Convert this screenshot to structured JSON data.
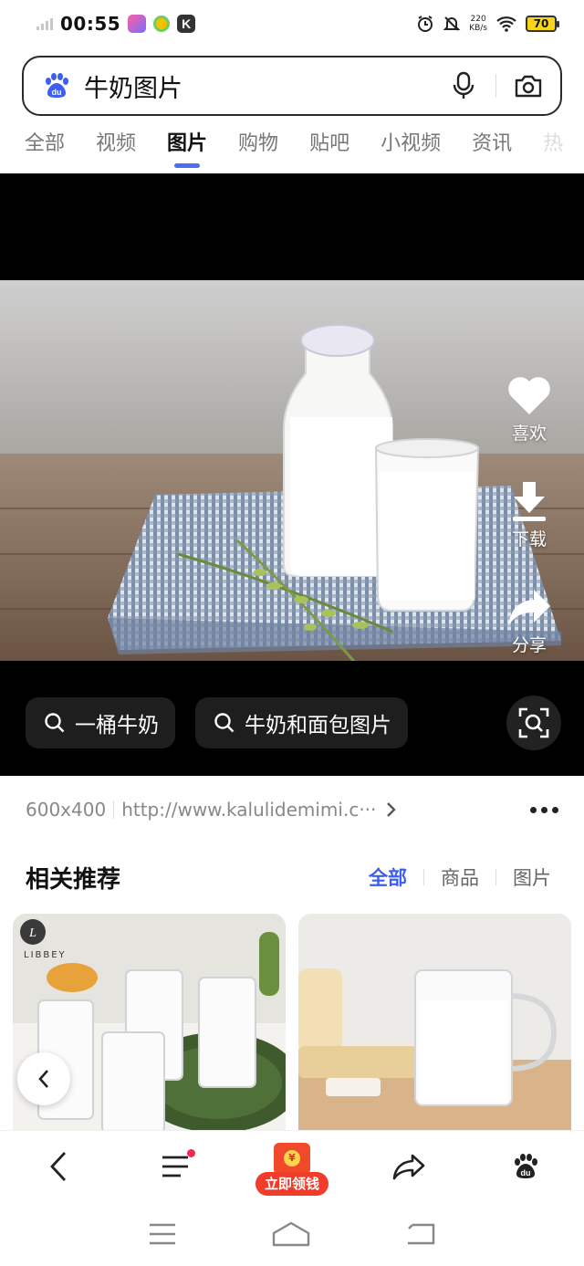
{
  "status_bar": {
    "time": "00:55",
    "net_speed_value": "220",
    "net_speed_unit": "KB/s",
    "battery": "70",
    "app_icon_k": "K"
  },
  "search": {
    "query": "牛奶图片"
  },
  "tabs": [
    "全部",
    "视频",
    "图片",
    "购物",
    "贴吧",
    "小视频",
    "资讯",
    "热"
  ],
  "active_tab": "图片",
  "viewer": {
    "actions": {
      "like": "喜欢",
      "download": "下载",
      "share": "分享"
    },
    "suggestions": [
      "一桶牛奶",
      "牛奶和面包图片"
    ]
  },
  "info": {
    "size": "600x400",
    "url": "http://www.kalulidemimi.c···"
  },
  "related": {
    "title": "相关推荐",
    "filters": [
      "全部",
      "商品",
      "图片"
    ],
    "card1_brand": "LIBBEY"
  },
  "bottom_nav": {
    "reward_label": "立即领钱",
    "coin_symbol": "¥"
  },
  "colors": {
    "accent": "#4e6ef2",
    "reward_red": "#f23c2a"
  }
}
